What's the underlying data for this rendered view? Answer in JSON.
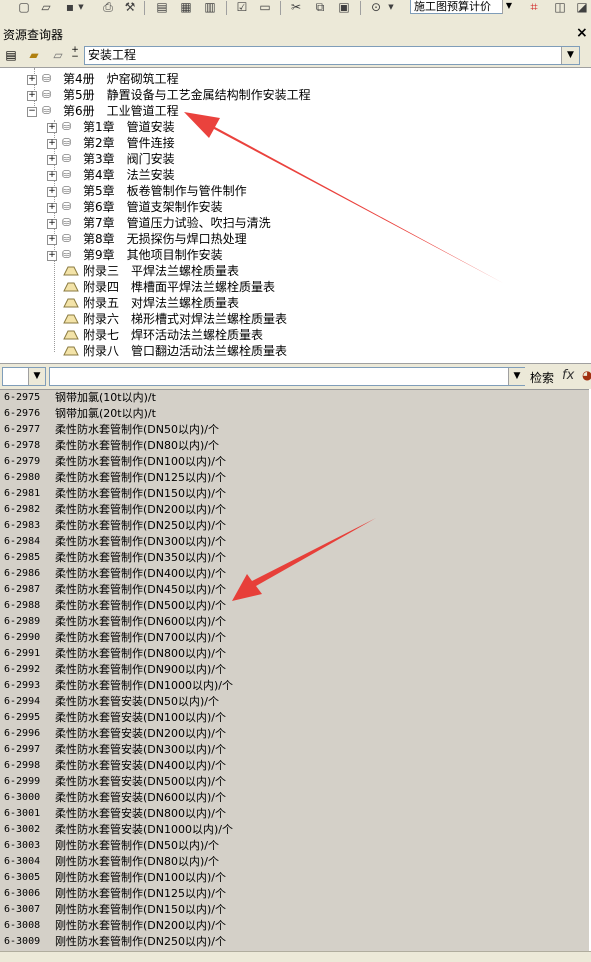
{
  "toolbar": {
    "combo_value": "施工图预算计价",
    "icons": [
      "new-icon",
      "open-icon",
      "save-icon",
      "print-icon",
      "tools-icon",
      "copy-row-icon",
      "table-icon",
      "grid-icon",
      "check-icon",
      "preview-icon",
      "cut-icon",
      "copy-icon",
      "paste-icon",
      "search-icon",
      "frame-icon",
      "window-icon"
    ]
  },
  "panel": {
    "title": "资源查询器",
    "close_label": "×"
  },
  "selector": {
    "value": "安装工程"
  },
  "tree": {
    "nodes": [
      {
        "label": "第4册　炉窑砌筑工程"
      },
      {
        "label": "第5册　静置设备与工艺金属结构制作安装工程"
      },
      {
        "label": "第6册　工业管道工程"
      },
      {
        "label": "第1章　管道安装"
      },
      {
        "label": "第2章　管件连接"
      },
      {
        "label": "第3章　阀门安装"
      },
      {
        "label": "第4章　法兰安装"
      },
      {
        "label": "第5章　板卷管制作与管件制作"
      },
      {
        "label": "第6章　管道支架制作安装"
      },
      {
        "label": "第7章　管道压力试验、吹扫与清洗"
      },
      {
        "label": "第8章　无损探伤与焊口热处理"
      },
      {
        "label": "第9章　其他项目制作安装"
      },
      {
        "label": "附录三　平焊法兰螺栓质量表"
      },
      {
        "label": "附录四　榫槽面平焊法兰螺栓质量表"
      },
      {
        "label": "附录五　对焊法兰螺栓质量表"
      },
      {
        "label": "附录六　梯形槽式对焊法兰螺栓质量表"
      },
      {
        "label": "附录七　焊环活动法兰螺栓质量表"
      },
      {
        "label": "附录八　管口翻边活动法兰螺栓质量表"
      }
    ]
  },
  "search": {
    "filter_value": "",
    "input_value": "",
    "button_label": "检索",
    "formula_icon": "fx"
  },
  "quota_list": {
    "rows": [
      {
        "code": "6-2975",
        "name": "钢带加氯(10t以内)/t"
      },
      {
        "code": "6-2976",
        "name": "钢带加氯(20t以内)/t"
      },
      {
        "code": "6-2977",
        "name": "柔性防水套管制作(DN50以内)/个"
      },
      {
        "code": "6-2978",
        "name": "柔性防水套管制作(DN80以内)/个"
      },
      {
        "code": "6-2979",
        "name": "柔性防水套管制作(DN100以内)/个"
      },
      {
        "code": "6-2980",
        "name": "柔性防水套管制作(DN125以内)/个"
      },
      {
        "code": "6-2981",
        "name": "柔性防水套管制作(DN150以内)/个"
      },
      {
        "code": "6-2982",
        "name": "柔性防水套管制作(DN200以内)/个"
      },
      {
        "code": "6-2983",
        "name": "柔性防水套管制作(DN250以内)/个"
      },
      {
        "code": "6-2984",
        "name": "柔性防水套管制作(DN300以内)/个"
      },
      {
        "code": "6-2985",
        "name": "柔性防水套管制作(DN350以内)/个"
      },
      {
        "code": "6-2986",
        "name": "柔性防水套管制作(DN400以内)/个"
      },
      {
        "code": "6-2987",
        "name": "柔性防水套管制作(DN450以内)/个"
      },
      {
        "code": "6-2988",
        "name": "柔性防水套管制作(DN500以内)/个"
      },
      {
        "code": "6-2989",
        "name": "柔性防水套管制作(DN600以内)/个"
      },
      {
        "code": "6-2990",
        "name": "柔性防水套管制作(DN700以内)/个"
      },
      {
        "code": "6-2991",
        "name": "柔性防水套管制作(DN800以内)/个"
      },
      {
        "code": "6-2992",
        "name": "柔性防水套管制作(DN900以内)/个"
      },
      {
        "code": "6-2993",
        "name": "柔性防水套管制作(DN1000以内)/个"
      },
      {
        "code": "6-2994",
        "name": "柔性防水套管安装(DN50以内)/个"
      },
      {
        "code": "6-2995",
        "name": "柔性防水套管安装(DN100以内)/个"
      },
      {
        "code": "6-2996",
        "name": "柔性防水套管安装(DN200以内)/个"
      },
      {
        "code": "6-2997",
        "name": "柔性防水套管安装(DN300以内)/个"
      },
      {
        "code": "6-2998",
        "name": "柔性防水套管安装(DN400以内)/个"
      },
      {
        "code": "6-2999",
        "name": "柔性防水套管安装(DN500以内)/个"
      },
      {
        "code": "6-3000",
        "name": "柔性防水套管安装(DN600以内)/个"
      },
      {
        "code": "6-3001",
        "name": "柔性防水套管安装(DN800以内)/个"
      },
      {
        "code": "6-3002",
        "name": "柔性防水套管安装(DN1000以内)/个"
      },
      {
        "code": "6-3003",
        "name": "刚性防水套管制作(DN50以内)/个"
      },
      {
        "code": "6-3004",
        "name": "刚性防水套管制作(DN80以内)/个"
      },
      {
        "code": "6-3005",
        "name": "刚性防水套管制作(DN100以内)/个"
      },
      {
        "code": "6-3006",
        "name": "刚性防水套管制作(DN125以内)/个"
      },
      {
        "code": "6-3007",
        "name": "刚性防水套管制作(DN150以内)/个"
      },
      {
        "code": "6-3008",
        "name": "刚性防水套管制作(DN200以内)/个"
      },
      {
        "code": "6-3009",
        "name": "刚性防水套管制作(DN250以内)/个"
      }
    ]
  },
  "colors": {
    "chrome": "#ece9d8",
    "list_bg": "#d4d0c8",
    "arrow": "#e8322c"
  }
}
